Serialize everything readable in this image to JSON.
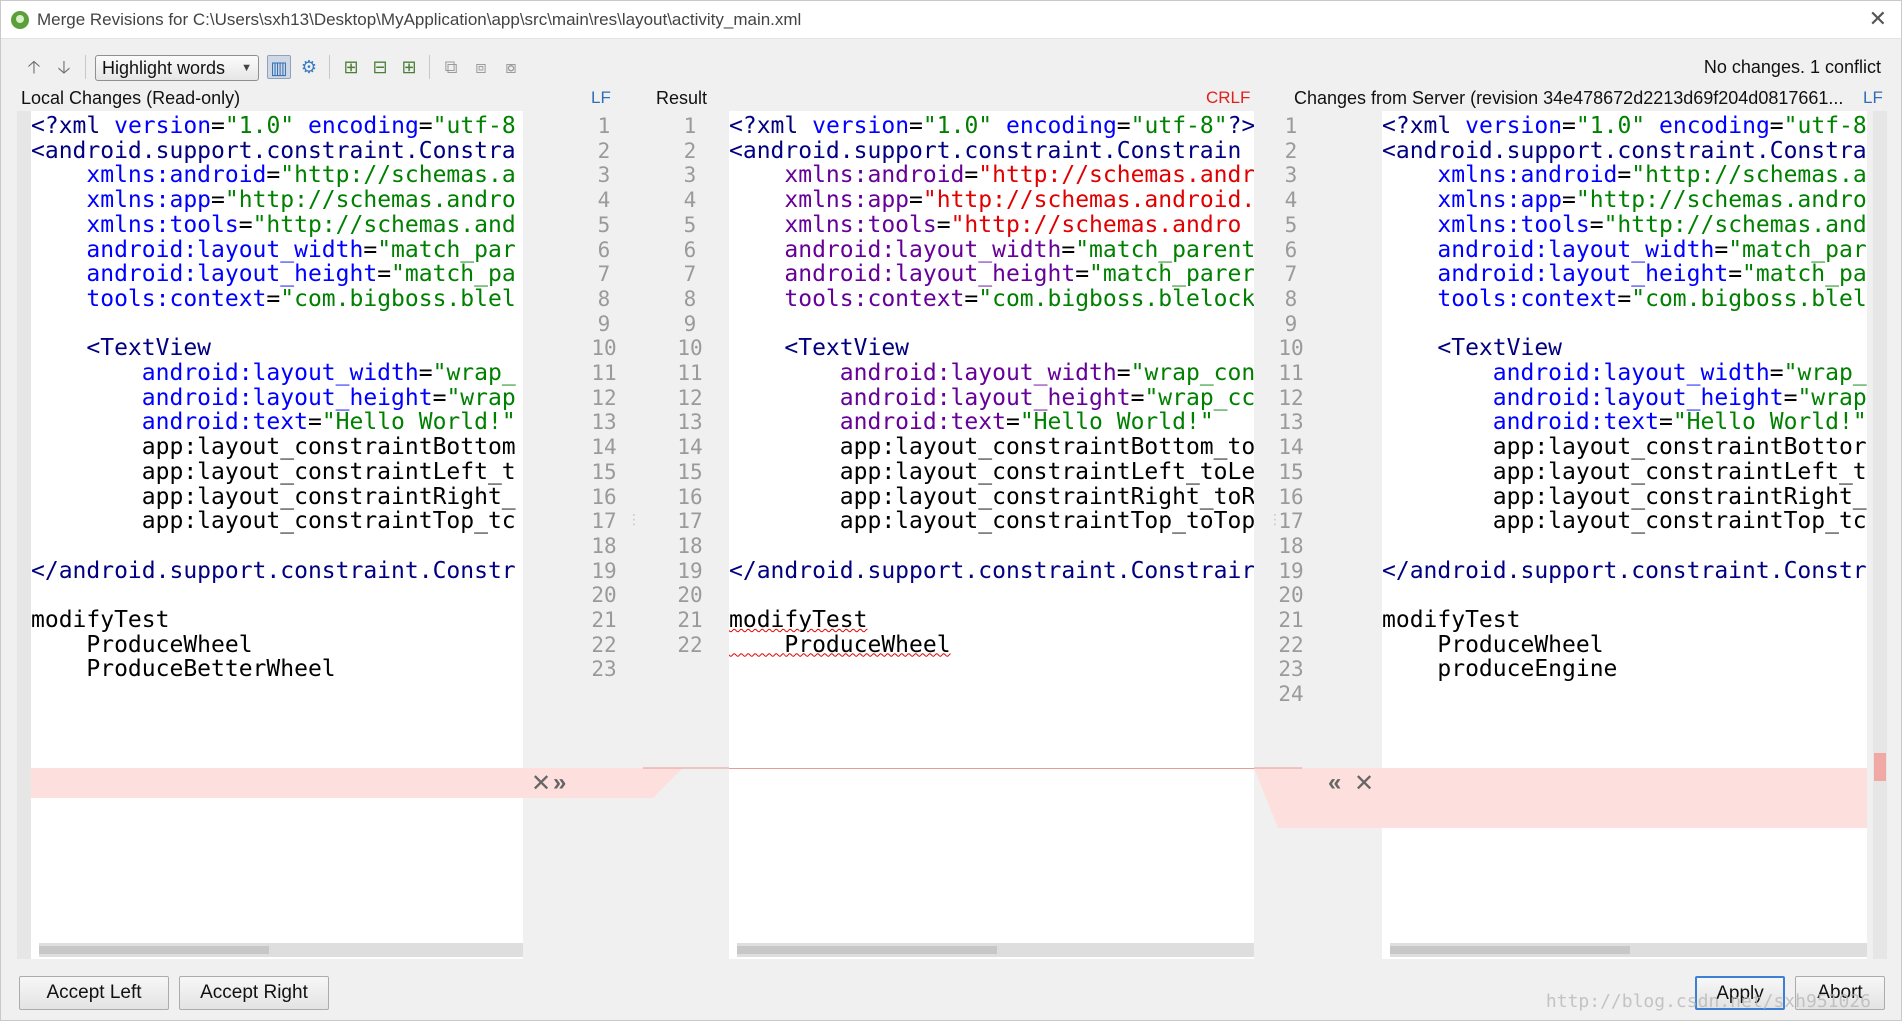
{
  "window": {
    "title": "Merge Revisions for C:\\Users\\sxh13\\Desktop\\MyApplication\\app\\src\\main\\res\\layout\\activity_main.xml",
    "close_icon": "close-icon"
  },
  "toolbar": {
    "highlight_mode": "Highlight words",
    "status": "No changes. 1 conflict",
    "icons": [
      "arrow-up-icon",
      "arrow-down-icon",
      "side-by-side-icon",
      "settings-icon",
      "apply-left-icon",
      "apply-all-icon",
      "apply-right-icon",
      "magic-resolve-icon",
      "accept-nonconflicting-icon",
      "revert-icon"
    ]
  },
  "panes": {
    "left": {
      "title": "Local Changes (Read-only)",
      "line_sep": "LF"
    },
    "center": {
      "title": "Result",
      "line_sep": "CRLF"
    },
    "right": {
      "title": "Changes from Server (revision 34e478672d2213d69f204d0817661...",
      "line_sep": "LF"
    }
  },
  "left_lines": [
    "<?xml version=\"1.0\" encoding=\"utf-8",
    "<android.support.constraint.Constra",
    "    xmlns:android=\"http://schemas.a",
    "    xmlns:app=\"http://schemas.andro",
    "    xmlns:tools=\"http://schemas.and",
    "    android:layout_width=\"match_par",
    "    android:layout_height=\"match_pa",
    "    tools:context=\"com.bigboss.blel",
    "",
    "    <TextView",
    "        android:layout_width=\"wrap_",
    "        android:layout_height=\"wrap",
    "        android:text=\"Hello World!\"",
    "        app:layout_constraintBottom",
    "        app:layout_constraintLeft_t",
    "        app:layout_constraintRight_",
    "        app:layout_constraintTop_tc",
    "",
    "</android.support.constraint.Constr",
    "",
    "modifyTest",
    "    ProduceWheel",
    "    ProduceBetterWheel"
  ],
  "center_lines": [
    "<?xml version=\"1.0\" encoding=\"utf-8\"?>",
    "<android.support.constraint.Constrain",
    "    xmlns:android=\"http://schemas.andr",
    "    xmlns:app=\"http://schemas.android.",
    "    xmlns:tools=\"http://schemas.andro",
    "    android:layout_width=\"match_parent",
    "    android:layout_height=\"match_parer",
    "    tools:context=\"com.bigboss.blelock",
    "",
    "    <TextView",
    "        android:layout_width=\"wrap_con",
    "        android:layout_height=\"wrap_cc",
    "        android:text=\"Hello World!\"",
    "        app:layout_constraintBottom_to",
    "        app:layout_constraintLeft_toLe",
    "        app:layout_constraintRight_toR",
    "        app:layout_constraintTop_toTop",
    "",
    "</android.support.constraint.Constrair",
    "",
    "modifyTest",
    "    ProduceWheel"
  ],
  "right_lines": [
    "<?xml version=\"1.0\" encoding=\"utf-8",
    "<android.support.constraint.Constra",
    "    xmlns:android=\"http://schemas.a",
    "    xmlns:app=\"http://schemas.andro",
    "    xmlns:tools=\"http://schemas.and",
    "    android:layout_width=\"match_par",
    "    android:layout_height=\"match_pa",
    "    tools:context=\"com.bigboss.blel",
    "",
    "    <TextView",
    "        android:layout_width=\"wrap_",
    "        android:layout_height=\"wrap",
    "        android:text=\"Hello World!\"",
    "        app:layout_constraintBottor",
    "        app:layout_constraintLeft_t",
    "        app:layout_constraintRight_",
    "        app:layout_constraintTop_tc",
    "",
    "</android.support.constraint.Constr",
    "",
    "modifyTest",
    "    ProduceWheel",
    "    produceEngine",
    ""
  ],
  "left_gutter_numbers": [
    "1",
    "2",
    "3",
    "4",
    "5",
    "6",
    "7",
    "8",
    "9",
    "10",
    "11",
    "12",
    "13",
    "14",
    "15",
    "16",
    "17",
    "18",
    "19",
    "20",
    "21",
    "22",
    "23"
  ],
  "center_gutter_numbers": [
    "1",
    "2",
    "3",
    "4",
    "5",
    "6",
    "7",
    "8",
    "9",
    "10",
    "11",
    "12",
    "13",
    "14",
    "15",
    "16",
    "17",
    "18",
    "19",
    "20",
    "21",
    "22"
  ],
  "right_gutter_numbers": [
    "1",
    "2",
    "3",
    "4",
    "5",
    "6",
    "7",
    "8",
    "9",
    "10",
    "11",
    "12",
    "13",
    "14",
    "15",
    "16",
    "17",
    "18",
    "19",
    "20",
    "21",
    "22",
    "23",
    "24"
  ],
  "conflict_controls": {
    "left_ignore": "✕",
    "left_apply": "»",
    "right_apply": "«",
    "right_ignore": "✕"
  },
  "buttons": {
    "accept_left": "Accept Left",
    "accept_right": "Accept Right",
    "apply": "Apply",
    "abort": "Abort"
  },
  "watermark": "http://blog.csdn.net/sxh951026",
  "colors": {
    "conflict": "#fde0de",
    "attr": "#0000ff",
    "value": "#008000",
    "result_attr": "#660099",
    "result_value": "#e00000",
    "lf": "#2f6eb5",
    "crlf": "#e02020"
  }
}
